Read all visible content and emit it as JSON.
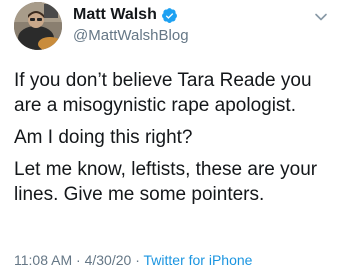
{
  "author": {
    "name": "Matt Walsh",
    "handle": "@MattWalshBlog",
    "verified_icon": "verified-badge-icon",
    "verified_color": "#1da1f2"
  },
  "tweet": {
    "paragraphs": [
      "If you don’t believe Tara Reade you are a misogynistic rape apologist.",
      "Am I doing this right?",
      "Let me know, leftists, these are your lines. Give me some pointers."
    ]
  },
  "meta": {
    "time": "11:08 AM",
    "separator": "·",
    "date": "4/30/20",
    "source": "Twitter for iPhone"
  },
  "menu": {
    "icon": "chevron-down-icon"
  },
  "colors": {
    "text": "#14171a",
    "secondary": "#657786",
    "link": "#1b95e0"
  }
}
